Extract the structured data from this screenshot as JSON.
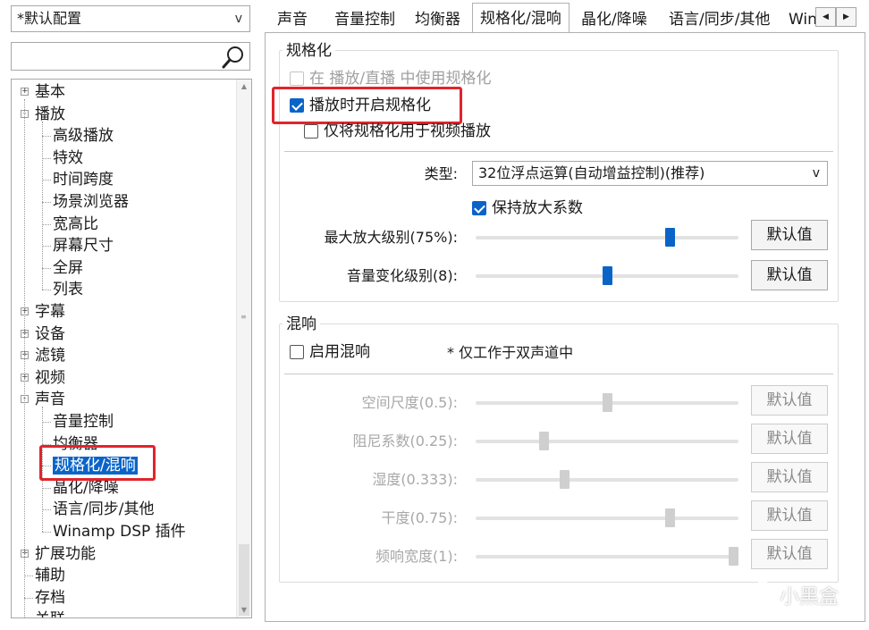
{
  "profile": {
    "selected": "*默认配置"
  },
  "search": {
    "value": "",
    "placeholder": ""
  },
  "tree": [
    {
      "label": "基本",
      "level": 0,
      "expander": "+"
    },
    {
      "label": "播放",
      "level": 0,
      "expander": "-"
    },
    {
      "label": "高级播放",
      "level": 1
    },
    {
      "label": "特效",
      "level": 1
    },
    {
      "label": "时间跨度",
      "level": 1
    },
    {
      "label": "场景浏览器",
      "level": 1
    },
    {
      "label": "宽高比",
      "level": 1
    },
    {
      "label": "屏幕尺寸",
      "level": 1
    },
    {
      "label": "全屏",
      "level": 1
    },
    {
      "label": "列表",
      "level": 1
    },
    {
      "label": "字幕",
      "level": 0,
      "expander": "+"
    },
    {
      "label": "设备",
      "level": 0,
      "expander": "+"
    },
    {
      "label": "滤镜",
      "level": 0,
      "expander": "+"
    },
    {
      "label": "视频",
      "level": 0,
      "expander": "+"
    },
    {
      "label": "声音",
      "level": 0,
      "expander": "-"
    },
    {
      "label": "音量控制",
      "level": 1
    },
    {
      "label": "均衡器",
      "level": 1
    },
    {
      "label": "规格化/混响",
      "level": 1,
      "selected": true
    },
    {
      "label": "晶化/降噪",
      "level": 1
    },
    {
      "label": "语言/同步/其他",
      "level": 1
    },
    {
      "label": "Winamp DSP 插件",
      "level": 1
    },
    {
      "label": "扩展功能",
      "level": 0,
      "expander": "+"
    },
    {
      "label": "辅助",
      "level": 0
    },
    {
      "label": "存档",
      "level": 0
    },
    {
      "label": "关联",
      "level": 0
    }
  ],
  "tabs": [
    {
      "label": "声音"
    },
    {
      "label": "音量控制"
    },
    {
      "label": "均衡器"
    },
    {
      "label": "规格化/混响",
      "active": true
    },
    {
      "label": "晶化/降噪"
    },
    {
      "label": "语言/同步/其他"
    },
    {
      "label": "Win"
    }
  ],
  "normalize": {
    "title": "规格化",
    "use_when_streaming": {
      "label": "在 播放/直播 中使用规格化",
      "checked": false,
      "enabled": false
    },
    "enable_on_play": {
      "label": "播放时开启规格化",
      "checked": true,
      "enabled": true
    },
    "video_only": {
      "label": "仅将规格化用于视频播放",
      "checked": false,
      "enabled": true
    },
    "type_label": "类型:",
    "type_value": "32位浮点运算(自动增益控制)(推荐)",
    "keep_gain": {
      "label": "保持放大系数",
      "checked": true
    },
    "max_gain": {
      "label": "最大放大级别(75%):",
      "value": 75,
      "min": 0,
      "max": 100,
      "button": "默认值"
    },
    "volume_change": {
      "label": "音量变化级别(8):",
      "value": 8,
      "min": 1,
      "max": 15,
      "button": "默认值"
    }
  },
  "reverb": {
    "title": "混响",
    "enable": {
      "label": "启用混响",
      "checked": false
    },
    "note": "* 仅工作于双声道中",
    "params": [
      {
        "label": "空间尺度(0.5):",
        "value": 0.5,
        "min": 0,
        "max": 1,
        "button": "默认值"
      },
      {
        "label": "阻尼系数(0.25):",
        "value": 0.25,
        "min": 0,
        "max": 1,
        "button": "默认值"
      },
      {
        "label": "湿度(0.333):",
        "value": 0.333,
        "min": 0,
        "max": 1,
        "button": "默认值"
      },
      {
        "label": "干度(0.75):",
        "value": 0.75,
        "min": 0,
        "max": 1,
        "button": "默认值"
      },
      {
        "label": "频响宽度(1):",
        "value": 1,
        "min": 0,
        "max": 1,
        "button": "默认值"
      }
    ]
  },
  "watermark": {
    "text": "小黑盒"
  }
}
